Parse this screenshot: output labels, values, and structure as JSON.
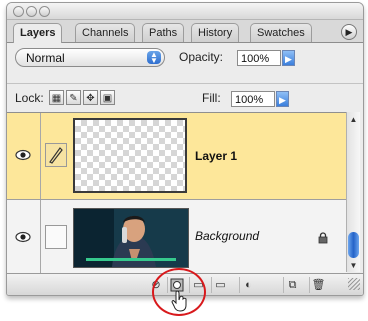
{
  "tabs": [
    {
      "label": "Layers",
      "active": true
    },
    {
      "label": "Channels",
      "active": false
    },
    {
      "label": "Paths",
      "active": false
    },
    {
      "label": "History",
      "active": false
    },
    {
      "label": "Swatches",
      "active": false
    }
  ],
  "blend_mode": {
    "value": "Normal"
  },
  "opacity": {
    "label": "Opacity:",
    "value": "100%"
  },
  "lock": {
    "label": "Lock:"
  },
  "fill": {
    "label": "Fill:",
    "value": "100%"
  },
  "layers": [
    {
      "name": "Layer 1",
      "selected": true,
      "visible": true
    },
    {
      "name": "Background",
      "selected": false,
      "visible": true,
      "locked": true
    }
  ],
  "bottom_toolbar": [
    "add-layer-style-icon",
    "add-layer-mask-icon",
    "new-group-icon",
    "new-adjustment-layer-icon",
    "new-layer-icon",
    "delete-layer-icon"
  ],
  "colors": {
    "selected_row": "#fde79a",
    "highlight_circle": "#d8191c",
    "accent_blue": "#2f6fd0"
  }
}
